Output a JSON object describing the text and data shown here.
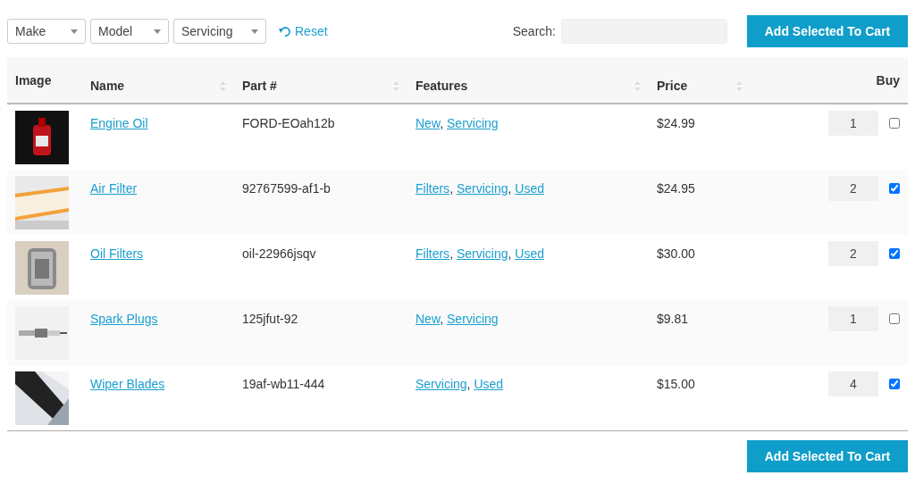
{
  "filters": [
    {
      "value": "Make"
    },
    {
      "value": "Model"
    },
    {
      "value": "Servicing"
    }
  ],
  "reset": "Reset",
  "search": {
    "label": "Search:"
  },
  "cart_button_top": "Add Selected To Cart",
  "table": {
    "feature_separator": ", ",
    "columns": [
      {
        "label": "Image",
        "sortable": false
      },
      {
        "label": "Name",
        "sortable": true
      },
      {
        "label": "Part #",
        "sortable": true
      },
      {
        "label": "Features",
        "sortable": true
      },
      {
        "label": "Price",
        "sortable": true
      },
      {
        "label": "Buy",
        "sortable": false
      }
    ],
    "rows": [
      {
        "image": {
          "kind": "picture"
        },
        "name": "Engine Oil",
        "part": "FORD-EOah12b",
        "features": [
          "New",
          "Servicing"
        ],
        "price": "$24.99",
        "quantity": "1",
        "checked": false
      },
      {
        "image": {
          "kind": "picture"
        },
        "name": "Air Filter",
        "part": "92767599-af1-b",
        "features": [
          "Filters",
          "Servicing",
          "Used"
        ],
        "price": "$24.95",
        "quantity": "2",
        "checked": true
      },
      {
        "image": {
          "kind": "picture"
        },
        "name": "Oil Filters",
        "part": "oil-22966jsqv",
        "features": [
          "Filters",
          "Servicing",
          "Used"
        ],
        "price": "$30.00",
        "quantity": "2",
        "checked": true
      },
      {
        "image": {
          "kind": "picture"
        },
        "name": "Spark Plugs",
        "part": "125jfut-92",
        "features": [
          "New",
          "Servicing"
        ],
        "price": "$9.81",
        "quantity": "1",
        "checked": false
      },
      {
        "image": {
          "kind": "picture"
        },
        "name": "Wiper Blades",
        "part": "19af-wb11-444",
        "features": [
          "Servicing",
          "Used"
        ],
        "price": "$15.00",
        "quantity": "4",
        "checked": true
      }
    ]
  },
  "cart_button_bottom": "Add Selected To Cart"
}
